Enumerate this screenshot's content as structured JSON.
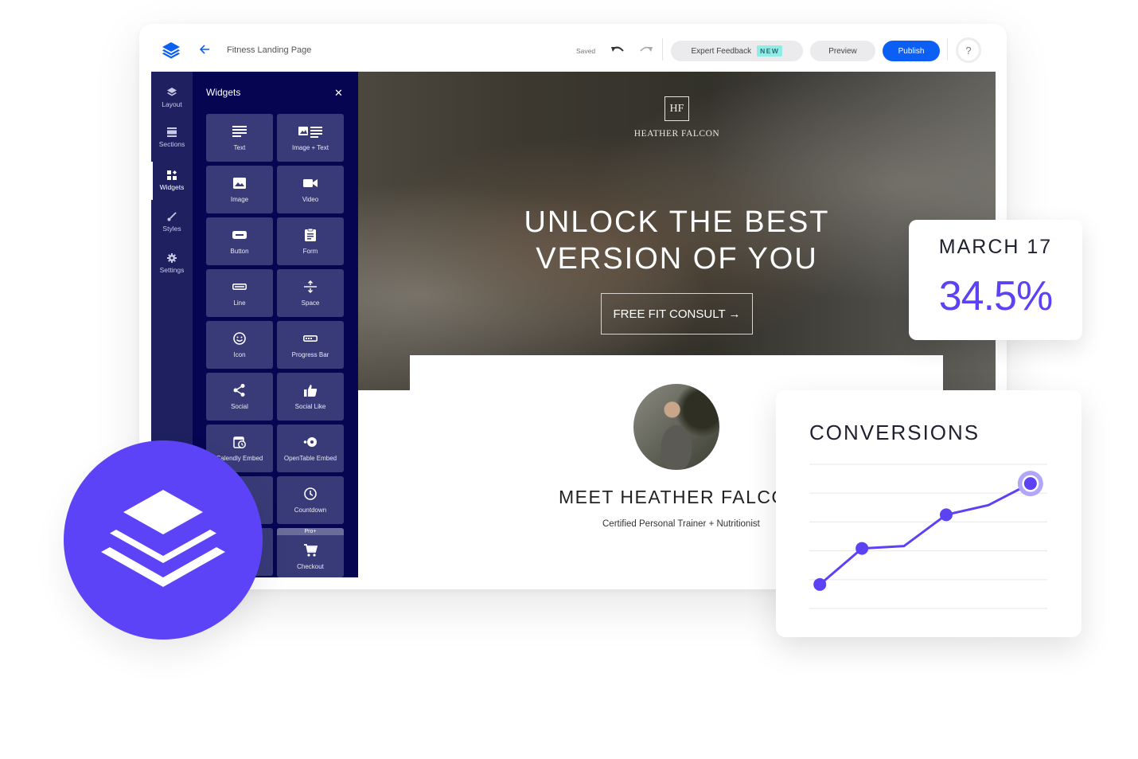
{
  "topbar": {
    "logo_icon": "layers-icon",
    "back_icon": "arrow-left-icon",
    "page_name": "Fitness Landing Page",
    "saved_label": "Saved",
    "undo_icon": "undo-icon",
    "redo_icon": "redo-icon",
    "expert_feedback_label": "Expert Feedback",
    "new_badge": "NEW",
    "preview_label": "Preview",
    "publish_label": "Publish",
    "help_label": "?"
  },
  "rail": {
    "items": [
      {
        "label": "Layout",
        "icon": "layers-icon"
      },
      {
        "label": "Sections",
        "icon": "sections-icon"
      },
      {
        "label": "Widgets",
        "icon": "widgets-icon",
        "active": true
      },
      {
        "label": "Styles",
        "icon": "brush-icon"
      },
      {
        "label": "Settings",
        "icon": "gear-icon"
      }
    ]
  },
  "panel": {
    "title": "Widgets",
    "close_label": "✕",
    "widgets": [
      {
        "label": "Text",
        "icon": "text-icon"
      },
      {
        "label": "Image + Text",
        "icon": "image-text-icon"
      },
      {
        "label": "Image",
        "icon": "image-icon"
      },
      {
        "label": "Video",
        "icon": "video-icon"
      },
      {
        "label": "Button",
        "icon": "button-icon"
      },
      {
        "label": "Form",
        "icon": "form-icon"
      },
      {
        "label": "Line",
        "icon": "line-icon"
      },
      {
        "label": "Space",
        "icon": "space-icon"
      },
      {
        "label": "Icon",
        "icon": "smiley-icon"
      },
      {
        "label": "Progress Bar",
        "icon": "progress-bar-icon"
      },
      {
        "label": "Social",
        "icon": "share-icon"
      },
      {
        "label": "Social Like",
        "icon": "thumbs-up-icon"
      },
      {
        "label": "Calendly Embed",
        "icon": "calendar-clock-icon"
      },
      {
        "label": "OpenTable Embed",
        "icon": "opentable-icon"
      },
      {
        "label": "",
        "icon": ""
      },
      {
        "label": "Countdown",
        "icon": "clock-icon"
      },
      {
        "label": "",
        "icon": ""
      },
      {
        "label": "Checkout",
        "icon": "cart-icon",
        "badge": "Pro+"
      }
    ]
  },
  "hero": {
    "logo_monogram": "HF",
    "brand_name": "HEATHER FALCON",
    "headline_line1": "UNLOCK THE BEST",
    "headline_line2": "VERSION OF YOU",
    "cta_label": "FREE FIT CONSULT →"
  },
  "about": {
    "title": "MEET HEATHER FALCON",
    "subtitle": "Certified Personal Trainer + Nutritionist"
  },
  "stat_card": {
    "date": "MARCH 17",
    "value": "34.5%"
  },
  "chart_card": {
    "title": "CONVERSIONS"
  },
  "chart_data": {
    "type": "line",
    "title": "CONVERSIONS",
    "xlabel": "",
    "ylabel": "",
    "x": [
      1,
      2,
      3,
      4,
      5,
      6
    ],
    "series": [
      {
        "name": "Conversions",
        "values": [
          1.0,
          2.5,
          2.6,
          3.9,
          4.3,
          5.2
        ],
        "markers": [
          true,
          true,
          false,
          true,
          false,
          true
        ]
      }
    ],
    "ylim": [
      0,
      6
    ],
    "grid": true,
    "highlight_index": 5,
    "color": "#5b43f5"
  },
  "brand_badge": {
    "icon": "layers-icon",
    "color": "#5d43f7"
  }
}
